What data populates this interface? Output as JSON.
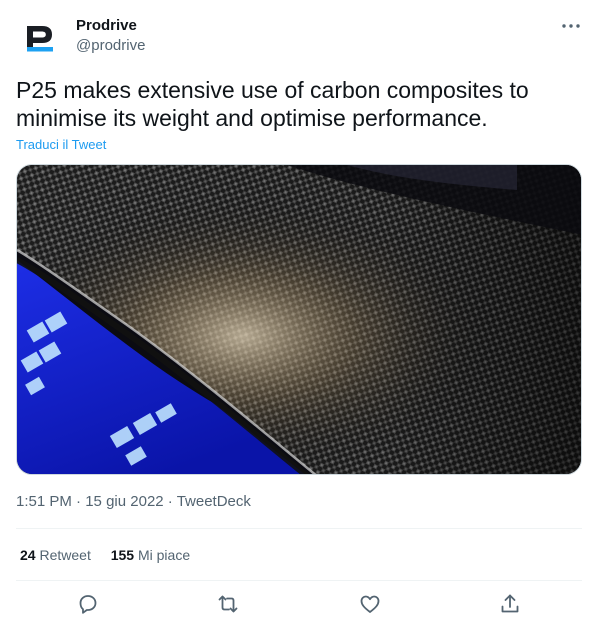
{
  "author": {
    "display_name": "Prodrive",
    "handle": "@prodrive",
    "avatar_icon": "prodrive-logo-icon"
  },
  "tweet": {
    "text": "P25 makes extensive use of carbon composites to minimise its weight and optimise performance.",
    "translate_label": "Traduci il Tweet",
    "time": "1:51 PM",
    "date": "15 giu 2022",
    "source": "TweetDeck",
    "separator": "·"
  },
  "stats": {
    "retweets_count": "24",
    "retweets_label": "Retweet",
    "likes_count": "155",
    "likes_label": "Mi piace"
  },
  "actions": [
    "reply-icon",
    "retweet-icon",
    "like-icon",
    "share-icon"
  ],
  "colors": {
    "link": "#1d9bf0",
    "secondary_text": "#536471",
    "primary_text": "#0f1419",
    "divider": "#eff3f4",
    "brand_blue": "#1da1f2",
    "brand_dark": "#1a1e24"
  }
}
